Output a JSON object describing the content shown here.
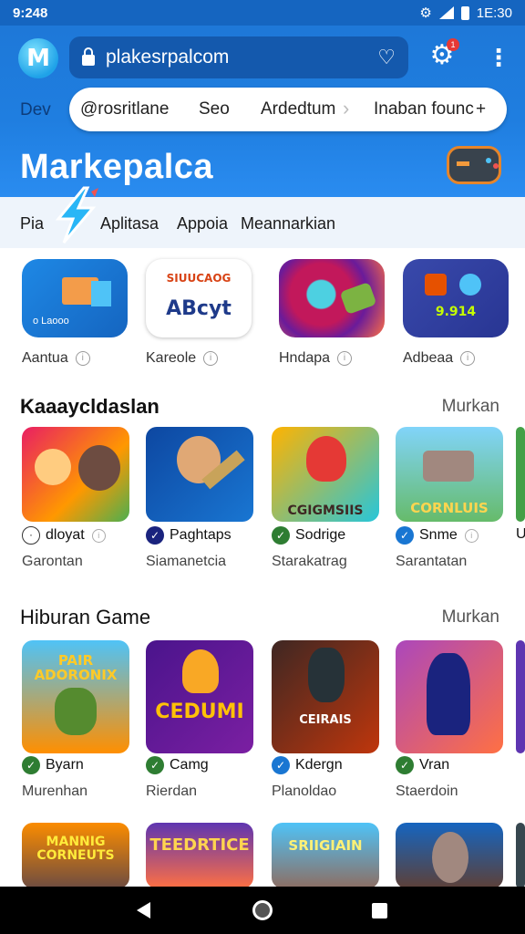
{
  "status_bar": {
    "time": "9:248",
    "right_time": "1E:30"
  },
  "browser": {
    "url": "plakesrpalcom",
    "bookmark_icon": "bookmark-icon",
    "settings_badge": "1"
  },
  "tabs": {
    "dev": "Dev",
    "items": [
      "@rosritlane",
      "Seo",
      "Ardedtum",
      "Inaban founc"
    ],
    "trailing_icon": "+"
  },
  "page": {
    "title": "Markepalca"
  },
  "subnav": {
    "items": [
      "Pia",
      "Aplitasa",
      "Appoia",
      "Meannarkian"
    ]
  },
  "apps": [
    {
      "label": "Aantua",
      "art": "sluucaog",
      "accent": "#1e88e5"
    },
    {
      "label": "Kareole",
      "art": "ABcyt",
      "accent": "#ffffff"
    },
    {
      "label": "Hndapa",
      "art": "",
      "accent": "#c2185b"
    },
    {
      "label": "Adbeaa",
      "art": "9.914",
      "accent": "#3949ab"
    }
  ],
  "apps_tile_text": [
    "o Laooo",
    "SIUUCAOG",
    "ABcyt",
    "",
    "9.914"
  ],
  "section1": {
    "title": "Kaaaycldaslan",
    "more": "Murkan",
    "games": [
      {
        "name": "dloyat",
        "sub": "Garontan",
        "badge": "ring",
        "art": ""
      },
      {
        "name": "Paghtaps",
        "sub": "Siamanetcia",
        "badge": "navy",
        "art": ""
      },
      {
        "name": "Sodrige",
        "sub": "Starakatrag",
        "badge": "check",
        "art": "CGIGMSIIS"
      },
      {
        "name": "Snme",
        "sub": "Sarantatan",
        "badge": "blue",
        "art": "CORNLUIS"
      },
      {
        "name": "U",
        "sub": "",
        "badge": "",
        "art": ""
      }
    ]
  },
  "section2": {
    "title": "Hiburan Game",
    "more": "Murkan",
    "games": [
      {
        "name": "Byarn",
        "sub": "Murenhan",
        "badge": "check",
        "art": "PAIR ADORONIX"
      },
      {
        "name": "Camg",
        "sub": "Rierdan",
        "badge": "check",
        "art": "CEDUMI"
      },
      {
        "name": "Kdergn",
        "sub": "Planoldao",
        "badge": "blue",
        "art": "CEIRAIS"
      },
      {
        "name": "Vran",
        "sub": "Staerdoin",
        "badge": "check",
        "art": ""
      }
    ]
  },
  "section3": {
    "games": [
      {
        "art": "MANNIG CORNEUTS"
      },
      {
        "art": "TEEDRTICE"
      },
      {
        "art": "SRIIGIAIN"
      },
      {
        "art": ""
      }
    ]
  },
  "nav": {
    "back": "back-icon",
    "home": "home-icon",
    "recents": "recents-icon"
  }
}
